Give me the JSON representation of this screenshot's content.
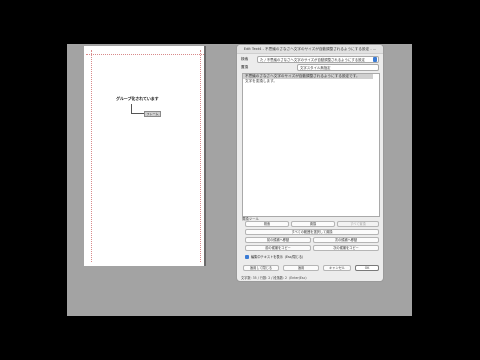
{
  "document": {
    "page_text": "グループ化されています",
    "frame_tag": "フレーム"
  },
  "dialog": {
    "title": "Edit Text4 - 不思議のさなさへ文字のサイズが自動調整されるようにする設定 - ...",
    "find": {
      "label": "検索",
      "value": "た / 不思議のさなさへ文字のサイズが自動調整されるようにする設定"
    },
    "replace": {
      "label": "置換",
      "value": "文字スタイル無指定"
    },
    "text_lines": [
      "不思議のさなさへ文字のサイズが自動調整されるようにする設定です。",
      "文字を変換します。"
    ],
    "section_label": "置換ツール",
    "buttons": {
      "search": "検索",
      "replace": "置換",
      "replace_all": "すべて置換",
      "select_all_range": "すべての範囲を選択して置換",
      "prev_match": "前の候補へ移動",
      "next_match": "次の候補へ移動",
      "copy_prev": "前の候補をコピー",
      "copy_next": "次の候補をコピー",
      "apply_and_close": "適用して閉じる",
      "apply": "適用",
      "cancel": "キャンセル",
      "ok": "OK"
    },
    "checkbox_label": "編集中テキストを表示（Esc/閉じる）",
    "status": "文字数: 35 / 行数: 2 / 段落数: 2（Enter/Esc）"
  }
}
